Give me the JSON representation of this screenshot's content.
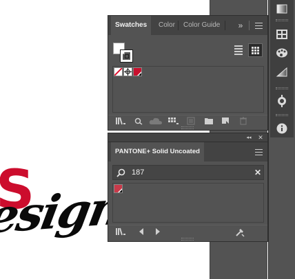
{
  "swatches_panel": {
    "tabs": [
      {
        "label": "Swatches",
        "active": true
      },
      {
        "label": "Color",
        "active": false
      },
      {
        "label": "Color Guide",
        "active": false
      }
    ],
    "overflow_glyph": "»",
    "view": "grid",
    "swatches": [
      "none",
      "registration",
      "crimson"
    ],
    "colors": {
      "crimson": "#c8102e"
    }
  },
  "pantone_panel": {
    "title": "PANTONE+ Solid Uncoated",
    "collapse_glyph": "◂◂",
    "close_glyph": "✕",
    "search": {
      "value": "187"
    },
    "clear_glyph": "✕",
    "result_swatch_color": "#c83a4a"
  },
  "toolstrip": {
    "icons": [
      "gradient-icon",
      "swatches-icon",
      "color-palette-icon",
      "gradient-ramp-icon",
      "appearance-icon",
      "info-icon"
    ]
  },
  "logo": {
    "letter": "S",
    "word": "esign"
  }
}
